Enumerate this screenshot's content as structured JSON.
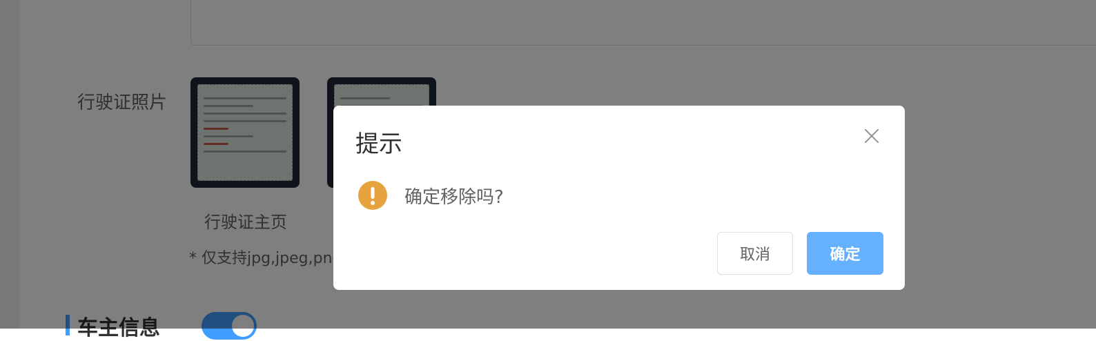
{
  "form": {
    "photo_label": "行驶证照片",
    "photo1_caption": "行驶证主页",
    "hint": "* 仅支持jpg,jpeg,png",
    "section_title": "车主信息"
  },
  "dialog": {
    "title": "提示",
    "message": "确定移除吗?",
    "cancel_label": "取消",
    "confirm_label": "确定"
  },
  "colors": {
    "primary": "#409eff",
    "confirm_button": "#66b1ff",
    "warning": "#e6a23c",
    "overlay": "rgba(0,0,0,0.5)"
  },
  "icons": {
    "close": "close-icon",
    "warning": "warning-icon"
  }
}
